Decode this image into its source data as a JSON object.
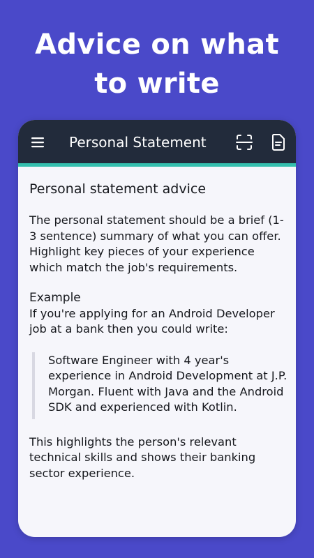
{
  "promo": {
    "title_line1": "Advice on what",
    "title_line2": "to write"
  },
  "appbar": {
    "title": "Personal Statement",
    "menu_icon": "hamburger-menu-icon",
    "scan_icon": "scan-icon",
    "document_icon": "document-icon",
    "accent_color": "#34bfae",
    "background_color": "#222b3b"
  },
  "content": {
    "heading": "Personal statement advice",
    "intro": "The personal statement should be a brief (1-3 sentence) summary of what you can offer. Highlight key pieces of your experience which match the job's requirements.",
    "example_label": "Example",
    "example_intro": "If you're applying for an Android Developer job at a bank then you could write:",
    "example_quote": "Software Engineer with 4 year's experience in Android Development at J.P. Morgan. Fluent with Java and the Android SDK and experienced with Kotlin.",
    "conclusion": "This highlights the person's relevant technical skills and shows their banking sector experience."
  },
  "colors": {
    "page_background": "#4a49c9",
    "card_background": "#f6f6fb"
  }
}
